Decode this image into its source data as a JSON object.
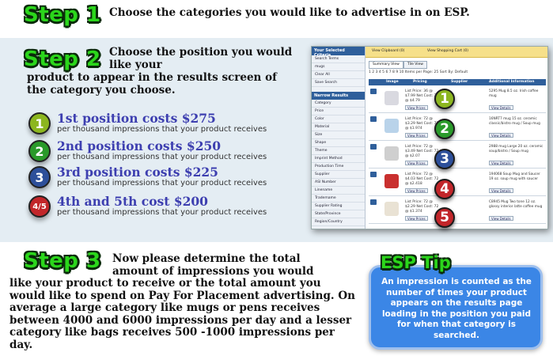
{
  "step1": {
    "badge": "Step 1",
    "text": "Choose the categories you would like to advertise in on ESP."
  },
  "step2": {
    "badge": "Step 2",
    "text_a": "Choose the position you would like your",
    "text_b": "product to appear in the results screen of the category you choose.",
    "positions": [
      {
        "num": "1",
        "title": "1st position costs $275",
        "sub": "per thousand impressions that your product receives",
        "color": "#8cb61f"
      },
      {
        "num": "2",
        "title": "2nd position costs $250",
        "sub": "per thousand impressions that your product receives",
        "color": "#2a9a2a"
      },
      {
        "num": "3",
        "title": "3rd position costs $225",
        "sub": "per thousand impressions that your product receives",
        "color": "#2d4f9a"
      },
      {
        "num": "4/5",
        "title": "4th and 5th cost $200",
        "sub": "per thousand impressions that your product receives",
        "color": "#c2262a"
      }
    ]
  },
  "thumbnail": {
    "side_header": "Your Selected Criteria",
    "side_items_top": [
      "Search Terms",
      "mugs",
      "Clear All",
      "Save Search"
    ],
    "side_header2": "Narrow Results",
    "side_items": [
      "Category",
      "Price",
      "Color",
      "Material",
      "Size",
      "Shape",
      "Theme",
      "Imprint Method",
      "Production Time",
      "Supplier",
      "ASI Number",
      "Linename",
      "Trademame",
      "Supplier Rating",
      "State/Province",
      "Region/Country"
    ],
    "topbar_left": "View Clipboard (0)",
    "topbar_right": "View Shopping Cart (0)",
    "tab_summary": "Summary View",
    "tab_tile": "Tile View",
    "toolbar": "1 2 3 4 5 6 7 8 9 10   Items per Page:  25   Sort By:  Default",
    "columns": [
      "Image",
      "Pricing",
      "Supplier",
      "Additional Information"
    ],
    "rows": [
      {
        "badge": "1",
        "price": "List Price: 36 @ $7.99  Net Cost: 36 @ $4.79",
        "desc": "5295 Mug  8.5 oz. Irish coffee mug",
        "color": "#8cb61f",
        "img": "#d9d9e0"
      },
      {
        "badge": "2",
        "price": "List Price: 72 @ $3.29  Net Cost: 72 @ $1.974",
        "desc": "16NRT7 mug  15 oz. ceramic classic/bistro mug / Soup mug",
        "color": "#2a9a2a",
        "img": "#b9d3ea"
      },
      {
        "badge": "3",
        "price": "List Price: 72 @ $3.49  Net Cost: 72 @ $2.07",
        "desc": "2988 mug  Large 20 oz. ceramic soup/bistro / Soup mug",
        "color": "#2d4f9a",
        "img": "#cfcfcf"
      },
      {
        "badge": "4",
        "price": "List Price: 72 @ $4.03  Net Cost: 72 @ $2.418",
        "desc": "194068 Soup Mug and Saucer  19 oz. soup mug with saucer",
        "color": "#c2262a",
        "img": "#c9302f"
      },
      {
        "badge": "5",
        "price": "List Price: 72 @ $2.29  Net Cost: 72 @ $1.374",
        "desc": "C8945 Mug  Two tone 12 oz. glossy interior latte coffee mug",
        "color": "#c2262a",
        "img": "#e9e2d4"
      }
    ],
    "row_btns": [
      "View Prices",
      "View Details"
    ]
  },
  "step3": {
    "badge": "Step 3",
    "first_text": "Now please determine the total amount of impressions you would",
    "text": "like your product to receive or the total amount you would like to spend on Pay For Placement advertising.  On average a large category like mugs or pens receives between 4000 and 6000 impressions per day and a lesser category like bags receives 500 -1000 impressions per day."
  },
  "tip": {
    "title": "ESP Tip",
    "text": "An impression is counted as the number of times your product appears on the results page loading in the position you paid for when that category is searched."
  }
}
